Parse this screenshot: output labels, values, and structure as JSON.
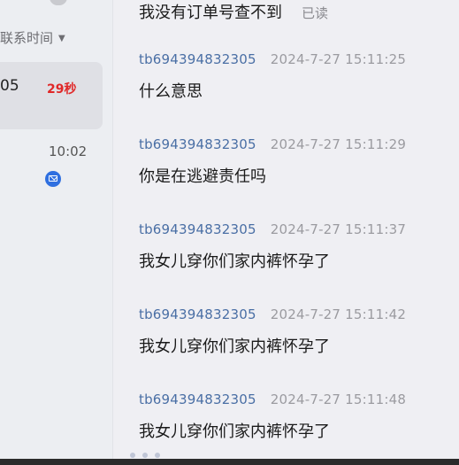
{
  "sidebar": {
    "sort_label": "联系时间",
    "active_contact": {
      "id_tail": "05",
      "wait_badge": "29秒"
    },
    "second_contact": {
      "time": "10:02"
    }
  },
  "chat": {
    "top_message": {
      "text": "我没有订单号查不到",
      "status": "已读"
    },
    "messages": [
      {
        "sender": "tb694394832305",
        "time": "2024-7-27 15:11:25",
        "text": "什么意思"
      },
      {
        "sender": "tb694394832305",
        "time": "2024-7-27 15:11:29",
        "text": "你是在逃避责任吗"
      },
      {
        "sender": "tb694394832305",
        "time": "2024-7-27 15:11:37",
        "text": "我女儿穿你们家内裤怀孕了"
      },
      {
        "sender": "tb694394832305",
        "time": "2024-7-27 15:11:42",
        "text": "我女儿穿你们家内裤怀孕了"
      },
      {
        "sender": "tb694394832305",
        "time": "2024-7-27 15:11:48",
        "text": "我女儿穿你们家内裤怀孕了"
      }
    ]
  }
}
